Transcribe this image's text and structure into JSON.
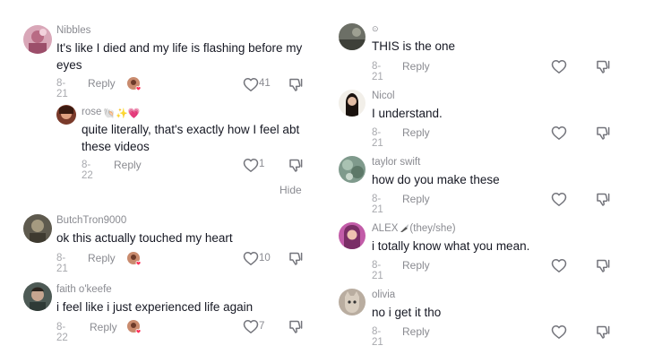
{
  "left": {
    "comments": [
      {
        "username": "Nibbles",
        "text": "It's like I died and my life is flashing before my eyes",
        "date": "8-21",
        "reply_label": "Reply",
        "likes": "41",
        "avatar_icon": "avatar-pink-photo",
        "creator_liked": true
      },
      {
        "username": "rose",
        "username_emojis": "🐚✨💗",
        "text": "quite literally, that's exactly how I feel abt these videos",
        "date": "8-22",
        "reply_label": "Reply",
        "likes": "1",
        "avatar_icon": "avatar-photo",
        "creator_liked": false
      },
      {
        "username": "ButchTron9000",
        "text": "ok this actually touched my heart",
        "date": "8-21",
        "reply_label": "Reply",
        "likes": "10",
        "avatar_icon": "avatar-photo",
        "creator_liked": true
      },
      {
        "username": "faith o'keefe",
        "text": "i feel like i just experienced life again",
        "date": "8-22",
        "reply_label": "Reply",
        "likes": "7",
        "avatar_icon": "avatar-photo",
        "creator_liked": true
      }
    ],
    "hide_label": "Hide"
  },
  "right": {
    "comments": [
      {
        "username": "⊙",
        "text": "THIS is the one",
        "date": "8-21",
        "reply_label": "Reply",
        "avatar_icon": "avatar-photo"
      },
      {
        "username": "Nicol",
        "text": "I understand.",
        "date": "8-21",
        "reply_label": "Reply",
        "avatar_icon": "avatar-photo"
      },
      {
        "username": "taylor swift",
        "text": "how do you make these",
        "date": "8-21",
        "reply_label": "Reply",
        "avatar_icon": "avatar-photo"
      },
      {
        "username": "ALEX",
        "username_suffix": "(they/she)",
        "text": "i totally know what you mean.",
        "date": "8-21",
        "reply_label": "Reply",
        "avatar_icon": "avatar-photo"
      },
      {
        "username": "olivia",
        "text": "no i get it tho",
        "date": "8-21",
        "reply_label": "Reply",
        "avatar_icon": "avatar-cat-photo"
      }
    ]
  },
  "colors": {
    "text": "#161823",
    "secondary": "#8a8b91",
    "date": "#a7a8ad",
    "creator_heart": "#fe2c55"
  },
  "icons": {
    "like": "heart-outline-icon",
    "dislike": "thumbs-down-icon",
    "creator_liked": "creator-liked-heart-icon"
  }
}
